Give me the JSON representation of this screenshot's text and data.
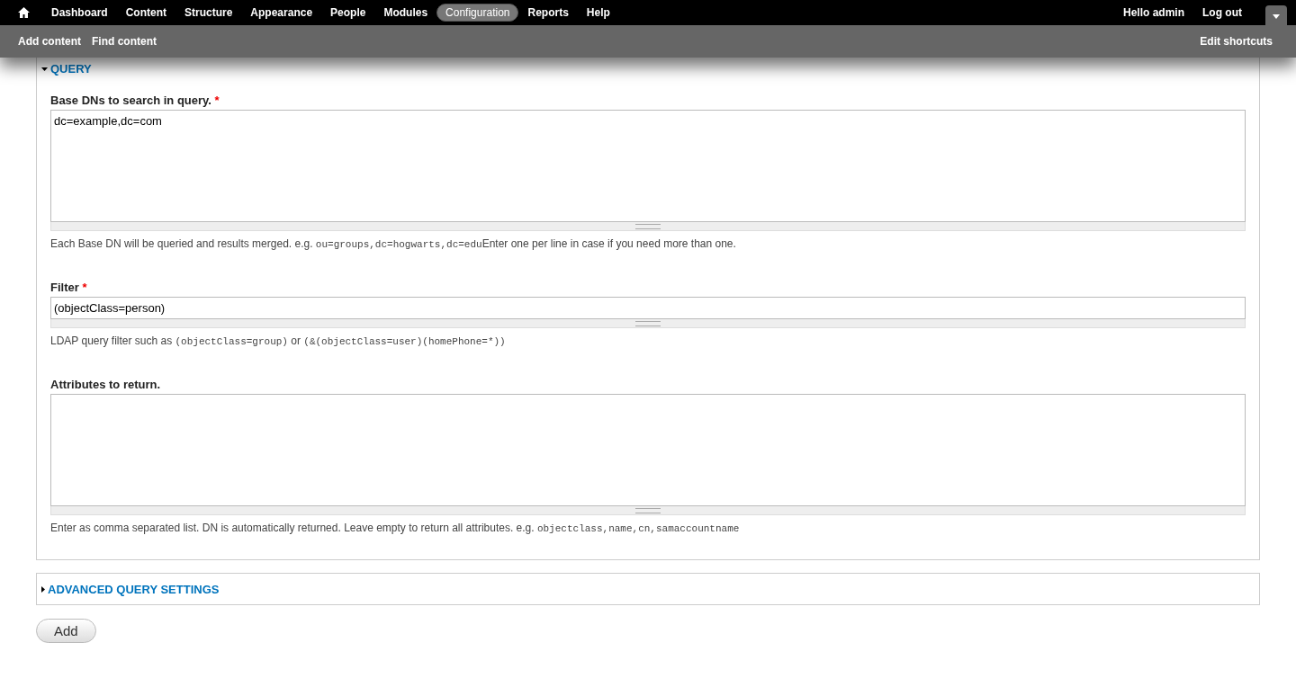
{
  "toolbar": {
    "menu": [
      {
        "label": "Dashboard",
        "selected": false
      },
      {
        "label": "Content",
        "selected": false
      },
      {
        "label": "Structure",
        "selected": false
      },
      {
        "label": "Appearance",
        "selected": false
      },
      {
        "label": "People",
        "selected": false
      },
      {
        "label": "Modules",
        "selected": false
      },
      {
        "label": "Configuration",
        "selected": true
      },
      {
        "label": "Reports",
        "selected": false
      },
      {
        "label": "Help",
        "selected": false
      }
    ],
    "greeting": {
      "prefix": "Hello ",
      "user": "admin"
    },
    "logout": "Log out",
    "shortcuts_expanded": true
  },
  "shortcuts": {
    "items": [
      "Add content",
      "Find content"
    ],
    "edit": "Edit shortcuts"
  },
  "fieldsets": [
    {
      "title": "QUERY",
      "expanded": true,
      "fields": [
        {
          "kind": "textarea",
          "label": "Base DNs to search in query.",
          "required_mark": "*",
          "value": "dc=example,dc=com",
          "description": [
            {
              "kind": "text",
              "text": "Each Base DN will be queried and results merged. e.g. "
            },
            {
              "kind": "code",
              "text": "ou=groups,dc=hogwarts,dc=edu"
            },
            {
              "kind": "text",
              "text": "Enter one per line in case if you need more than one."
            }
          ]
        },
        {
          "kind": "input",
          "label": "Filter",
          "required_mark": "*",
          "value": "(objectClass=person)",
          "description": [
            {
              "kind": "text",
              "text": "LDAP query filter such as "
            },
            {
              "kind": "code",
              "text": "(objectClass=group)"
            },
            {
              "kind": "text",
              "text": " or "
            },
            {
              "kind": "code",
              "text": "(&(objectClass=user)(homePhone=*))"
            }
          ]
        },
        {
          "kind": "textarea",
          "label": "Attributes to return.",
          "description": [
            {
              "kind": "text",
              "text": "Enter as comma separated list. DN is automatically returned. Leave empty to return all attributes. e.g. "
            },
            {
              "kind": "code",
              "text": "objectclass,name,cn,samaccountname"
            }
          ]
        }
      ]
    },
    {
      "title": "ADVANCED QUERY SETTINGS",
      "expanded": false
    }
  ],
  "submit": "Add"
}
